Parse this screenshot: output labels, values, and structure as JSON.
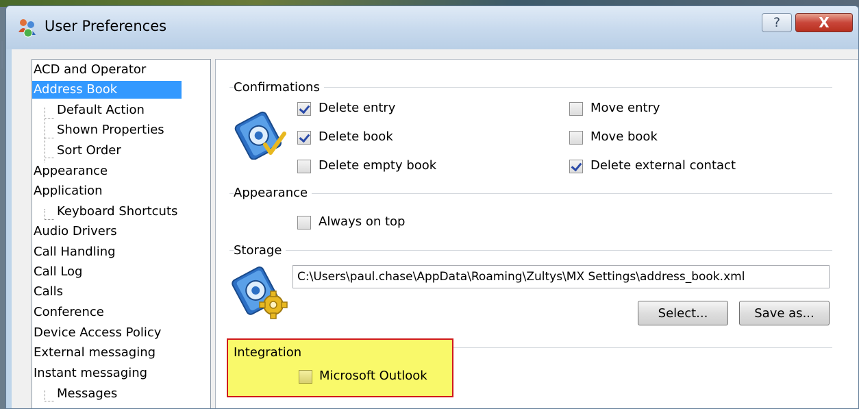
{
  "window": {
    "title": "User Preferences",
    "help_label": "?",
    "close_label": "X",
    "app_icon": "user-preferences-app-icon"
  },
  "tree": {
    "items": [
      {
        "label": "ACD and Operator",
        "level": 0,
        "selected": false
      },
      {
        "label": "Address Book",
        "level": 0,
        "selected": true
      },
      {
        "label": "Default Action",
        "level": 1,
        "selected": false
      },
      {
        "label": "Shown Properties",
        "level": 1,
        "selected": false
      },
      {
        "label": "Sort Order",
        "level": 1,
        "selected": false
      },
      {
        "label": "Appearance",
        "level": 0,
        "selected": false
      },
      {
        "label": "Application",
        "level": 0,
        "selected": false
      },
      {
        "label": "Keyboard Shortcuts",
        "level": 1,
        "selected": false
      },
      {
        "label": "Audio Drivers",
        "level": 0,
        "selected": false
      },
      {
        "label": "Call Handling",
        "level": 0,
        "selected": false
      },
      {
        "label": "Call Log",
        "level": 0,
        "selected": false
      },
      {
        "label": "Calls",
        "level": 0,
        "selected": false
      },
      {
        "label": "Conference",
        "level": 0,
        "selected": false
      },
      {
        "label": "Device Access Policy",
        "level": 0,
        "selected": false
      },
      {
        "label": "External messaging",
        "level": 0,
        "selected": false
      },
      {
        "label": "Instant messaging",
        "level": 0,
        "selected": false
      },
      {
        "label": "Messages",
        "level": 1,
        "selected": false
      }
    ]
  },
  "confirmations": {
    "title": "Confirmations",
    "icon": "address-book-check-icon",
    "delete_entry": {
      "label": "Delete entry",
      "checked": true
    },
    "delete_book": {
      "label": "Delete book",
      "checked": true
    },
    "delete_empty_book": {
      "label": "Delete empty book",
      "checked": false
    },
    "move_entry": {
      "label": "Move entry",
      "checked": false
    },
    "move_book": {
      "label": "Move book",
      "checked": false
    },
    "delete_external_contact": {
      "label": "Delete external contact",
      "checked": true
    }
  },
  "appearance": {
    "title": "Appearance",
    "always_on_top": {
      "label": "Always on top",
      "checked": false
    }
  },
  "storage": {
    "title": "Storage",
    "icon": "address-book-gear-icon",
    "path": "C:\\Users\\paul.chase\\AppData\\Roaming\\Zultys\\MX Settings\\address_book.xml",
    "select_label": "Select...",
    "save_as_label": "Save as..."
  },
  "integration": {
    "title": "Integration",
    "microsoft_outlook": {
      "label": "Microsoft Outlook",
      "checked": false
    },
    "highlight_color": "#f9f96a",
    "highlight_border": "#d01919"
  }
}
